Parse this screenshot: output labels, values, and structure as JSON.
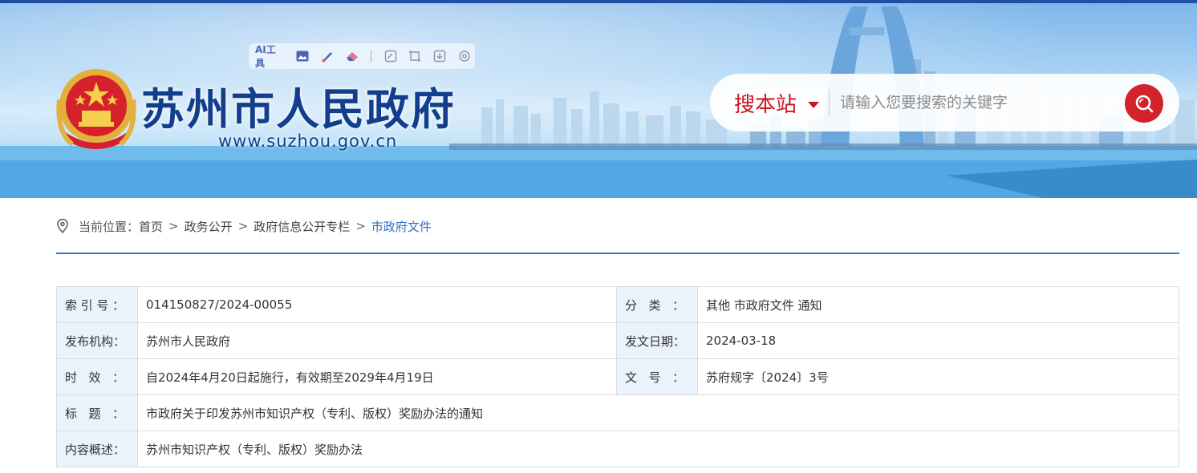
{
  "header": {
    "site_title": "苏州市人民政府",
    "site_url": "www.suzhou.gov.cn",
    "ai_toolbar": {
      "label": "AI工具",
      "tools": [
        "image-icon",
        "brush-icon",
        "eraser-icon",
        "edit-icon",
        "crop-icon",
        "download-icon",
        "settings-icon"
      ]
    },
    "search": {
      "scope": "搜本站",
      "placeholder": "请输入您要搜索的关键字"
    }
  },
  "breadcrumb": {
    "prefix": "当前位置：",
    "items": [
      "首页",
      "政务公开",
      "政府信息公开专栏",
      "市政府文件"
    ],
    "separator": ">"
  },
  "document_info": {
    "index_no": {
      "label_chars": [
        "索",
        "引",
        "号"
      ],
      "value": "014150827/2024-00055"
    },
    "category": {
      "label_chars": [
        "分",
        "类"
      ],
      "value": "其他 市政府文件 通知"
    },
    "issuer": {
      "label": "发布机构",
      "value": "苏州市人民政府"
    },
    "issue_date": {
      "label": "发文日期",
      "value": "2024-03-18"
    },
    "validity": {
      "label_chars": [
        "时",
        "效"
      ],
      "value": "自2024年4月20日起施行，有效期至2029年4月19日"
    },
    "doc_no": {
      "label_chars": [
        "文",
        "号"
      ],
      "value": "苏府规字〔2024〕3号"
    },
    "title": {
      "label_chars": [
        "标",
        "题"
      ],
      "value": "市政府关于印发苏州市知识产权（专利、版权）奖励办法的通知"
    },
    "summary": {
      "label": "内容概述",
      "value": "苏州市知识产权（专利、版权）奖励办法"
    },
    "colon": "："
  },
  "colors": {
    "title_blue": "#123e8d",
    "accent_red": "#c8191f",
    "link_blue": "#2b6fc2",
    "label_bg": "#eaf3fb"
  }
}
